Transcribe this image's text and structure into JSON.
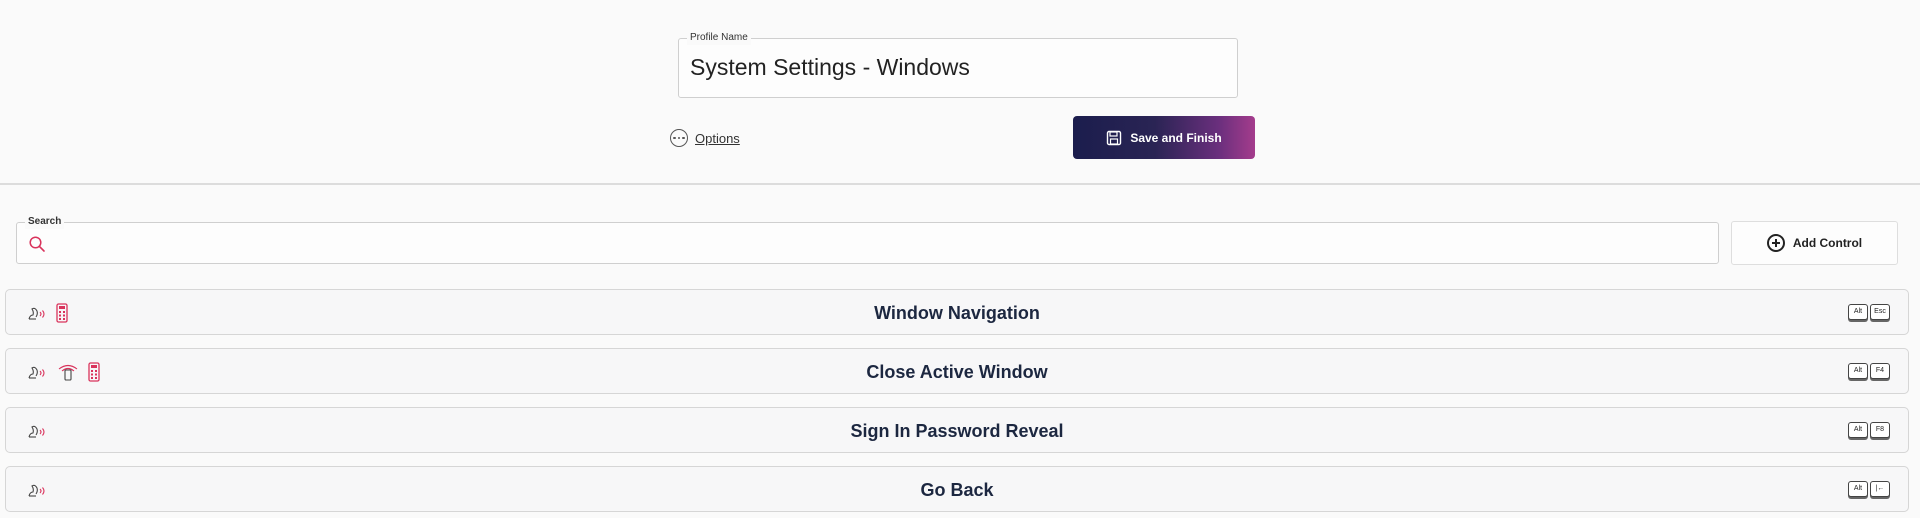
{
  "profile": {
    "legend": "Profile Name",
    "value": "System Settings - Windows"
  },
  "options": {
    "label": "Options"
  },
  "save": {
    "label": "Save and Finish"
  },
  "search": {
    "legend": "Search",
    "value": ""
  },
  "add_control": {
    "label": "Add Control"
  },
  "colors": {
    "accent": "#d9335c",
    "gradient_start": "#1b1d4d",
    "gradient_end": "#a43c8c",
    "title_text": "#1c2740"
  },
  "rows": [
    {
      "title": "Window Navigation",
      "icons": [
        "voice-icon",
        "keypad-icon"
      ],
      "keys": [
        "Alt",
        "Esc"
      ]
    },
    {
      "title": "Close Active Window",
      "icons": [
        "voice-icon",
        "switch-icon",
        "keypad-icon"
      ],
      "keys": [
        "Alt",
        "F4"
      ]
    },
    {
      "title": "Sign In Password Reveal",
      "icons": [
        "voice-icon"
      ],
      "keys": [
        "Alt",
        "F8"
      ]
    },
    {
      "title": "Go Back",
      "icons": [
        "voice-icon"
      ],
      "keys": [
        "Alt",
        "|←"
      ]
    }
  ]
}
